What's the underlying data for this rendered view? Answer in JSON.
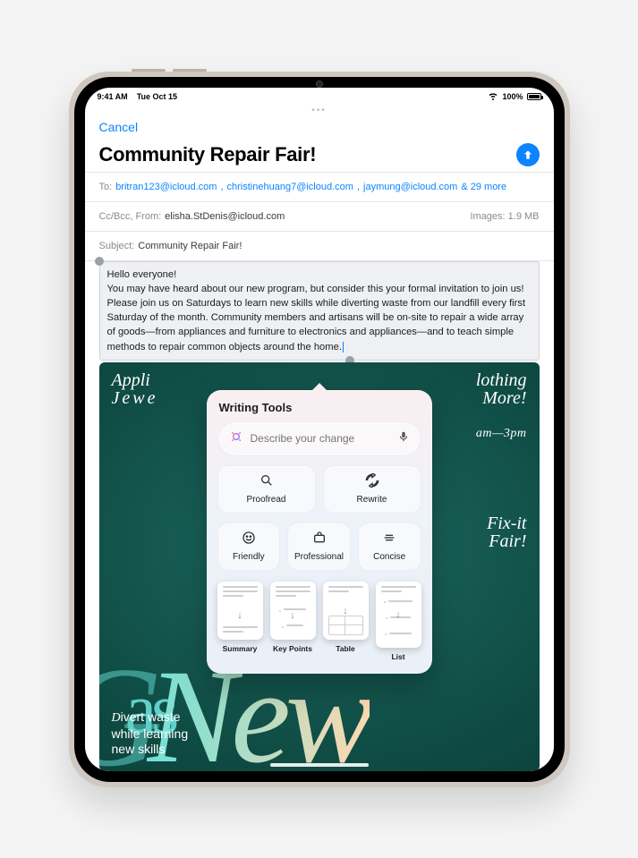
{
  "status": {
    "time": "9:41 AM",
    "date": "Tue Oct 15",
    "battery": "100%"
  },
  "nav": {
    "cancel": "Cancel"
  },
  "compose": {
    "title": "Community Repair Fair!",
    "to_label": "To:",
    "to_recipients": [
      "britran123@icloud.com",
      "christinehuang7@icloud.com",
      "jaymung@icloud.com"
    ],
    "to_more": "& 29 more",
    "ccbcc_label": "Cc/Bcc, From:",
    "from": "elisha.StDenis@icloud.com",
    "images_label": "Images:",
    "images_size": "1.9 MB",
    "subject_label": "Subject:",
    "subject": "Community Repair Fair!",
    "body_greeting": "Hello everyone!",
    "body_text": "You may have heard about our new program, but consider this your formal invitation to join us! Please join us on Saturdays to learn new skills while diverting waste from our landfill every first Saturday of the month. Community members and artisans will be on-site to repair a wide array of goods—from appliances and furniture to electronics and appliances—and to teach simple methods to repair common objects around the home."
  },
  "poster": {
    "lt1": "Appli",
    "lt2": "Jewe",
    "rt1": "lothing",
    "rt2": "More!",
    "time": "am—3pm",
    "rm1": "Fix-it",
    "rm2": "Fair!",
    "lb_pre": "D",
    "lb_rest": "ivert waste\nwhile learning\nnew skills",
    "big_as": "as",
    "big_new": "New"
  },
  "tools": {
    "title": "Writing Tools",
    "placeholder": "Describe your change",
    "proofread": "Proofread",
    "rewrite": "Rewrite",
    "friendly": "Friendly",
    "professional": "Professional",
    "concise": "Concise",
    "summary": "Summary",
    "keypoints": "Key Points",
    "table": "Table",
    "list": "List"
  }
}
